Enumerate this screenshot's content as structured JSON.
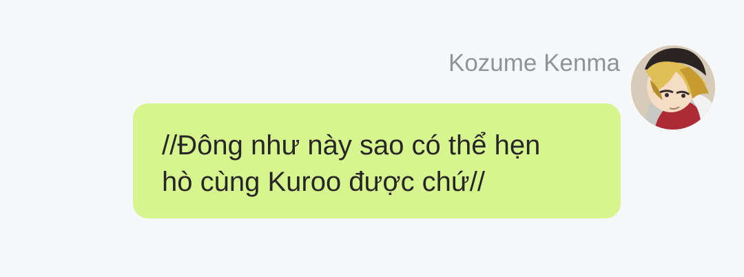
{
  "message": {
    "sender_name": "Kozume Kenma",
    "text": "//Đông như này sao có thể hẹn\nhò cùng Kuroo được chứ//",
    "bubble_color": "#d6f58f"
  },
  "avatar": {
    "icon": "kenma-avatar-icon"
  }
}
